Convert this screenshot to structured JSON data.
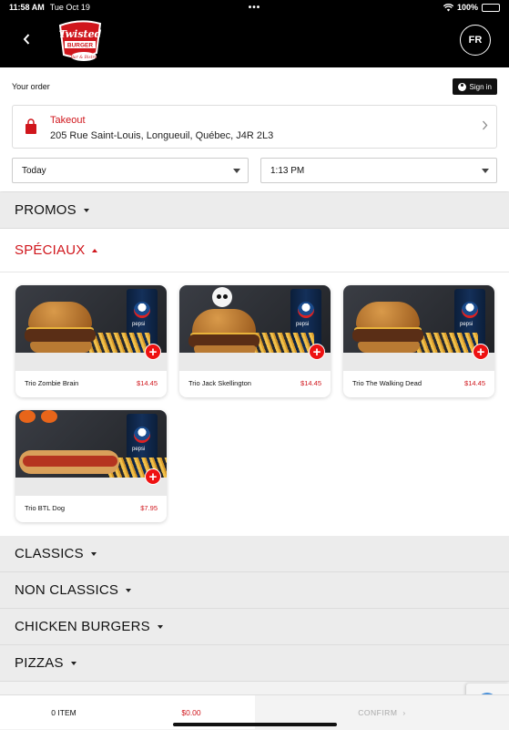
{
  "status_bar": {
    "time": "11:58 AM",
    "date": "Tue Oct 19",
    "dots": "•••",
    "battery": "100%"
  },
  "header": {
    "back_icon": "chevron-left-icon",
    "logo_text": "Twisted Burger",
    "language": "FR"
  },
  "order": {
    "label": "Your order",
    "signin_label": "Sign in",
    "mode_title": "Takeout",
    "address": "205 Rue Saint-Louis, Longueuil, Québec, J4R 2L3",
    "date_value": "Today",
    "time_value": "1:13 PM"
  },
  "categories": {
    "promos": "PROMOS",
    "speciaux": "SPÉCIAUX",
    "classics": "CLASSICS",
    "non_classics": "NON CLASSICS",
    "chicken": "CHICKEN BURGERS",
    "pizzas": "PIZZAS"
  },
  "products": [
    {
      "name": "Trio Zombie Brain",
      "price": "$14.45"
    },
    {
      "name": "Trio Jack Skellington",
      "price": "$14.45"
    },
    {
      "name": "Trio The Walking Dead",
      "price": "$14.45"
    },
    {
      "name": "Trio BTL Dog",
      "price": "$7.95"
    }
  ],
  "cup_text": "pepsi",
  "cart": {
    "items": "0 ITEM",
    "total": "$0.00",
    "confirm": "CONFIRM",
    "confirm_chevron": "›"
  },
  "colors": {
    "accent": "#d0161c",
    "header_bg": "#000000"
  }
}
